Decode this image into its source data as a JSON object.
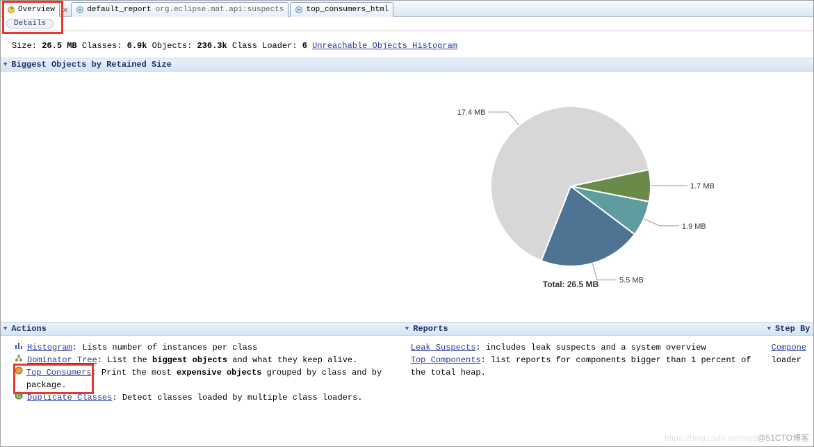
{
  "tabs": {
    "overview": "Overview",
    "default_report": "default_report",
    "default_report_suffix": "org.eclipse.mat.api:suspects",
    "top_consumers": "top_consumers_html"
  },
  "strip_label": "Details",
  "stats": {
    "size_label": "Size:",
    "size_value": "26.5 MB",
    "classes_label": "Classes:",
    "classes_value": "6.9k",
    "objects_label": "Objects:",
    "objects_value": "236.3k",
    "loader_label": "Class Loader:",
    "loader_value": "6",
    "histogram_link": "Unreachable Objects Histogram"
  },
  "section_biggest": "Biggest Objects by Retained Size",
  "section_actions": "Actions",
  "section_reports": "Reports",
  "section_step": "Step By",
  "actions": {
    "histogram": "Histogram",
    "histogram_desc": ": Lists number of instances per class",
    "dominator": "Dominator Tree",
    "dominator_desc_pre": ": List the ",
    "dominator_bold": "biggest objects",
    "dominator_desc_post": " and what they keep alive.",
    "top_consumers": "Top Consumers",
    "top_consumers_desc_pre": ": Print the most ",
    "top_consumers_bold": "expensive objects",
    "top_consumers_desc_post": " grouped by class and by package.",
    "dup_classes": "Duplicate Classes",
    "dup_classes_desc": ": Detect classes loaded by multiple class loaders."
  },
  "reports": {
    "leak": "Leak Suspects",
    "leak_desc": ": includes leak suspects and a system overview",
    "topc": "Top Components",
    "topc_desc": ": list reports for components bigger than 1 percent of the total heap."
  },
  "step": {
    "comp": "Compone",
    "comp_desc": "loader"
  },
  "chart_data": {
    "type": "pie",
    "title": "Total: 26.5 MB",
    "series": [
      {
        "name": "17.4 MB",
        "value": 17.4,
        "color": "#d7d7d7"
      },
      {
        "name": "1.7 MB",
        "value": 1.7,
        "color": "#6a8a4a"
      },
      {
        "name": "1.9 MB",
        "value": 1.9,
        "color": "#5f9ca0"
      },
      {
        "name": "5.5 MB",
        "value": 5.5,
        "color": "#4f7493"
      }
    ]
  },
  "watermark_faint": "https://blog.csdn.net/myd",
  "watermark": "@51CTO博客"
}
